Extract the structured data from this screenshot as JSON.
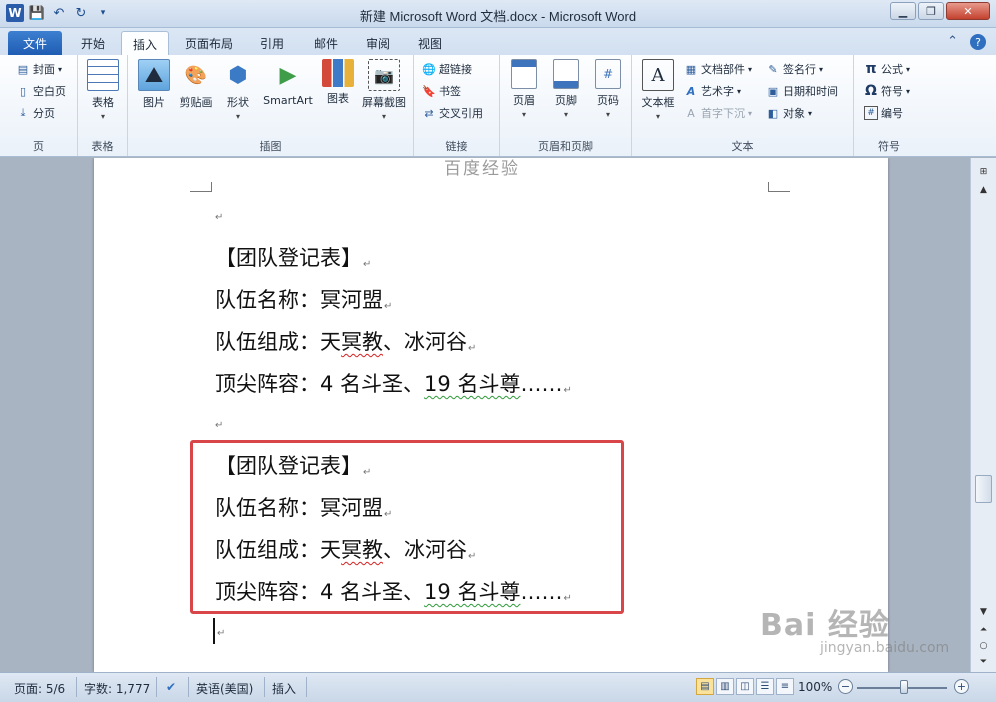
{
  "window": {
    "title": "新建 Microsoft Word 文档.docx - Microsoft Word",
    "app_icon": "W"
  },
  "tabs": {
    "file": "文件",
    "home": "开始",
    "insert": "插入",
    "page_layout": "页面布局",
    "references": "引用",
    "mailings": "邮件",
    "review": "审阅",
    "view": "视图"
  },
  "ribbon": {
    "pages": {
      "cover": "封面",
      "blank_page": "空白页",
      "page_break": "分页",
      "label": "页"
    },
    "tables": {
      "table": "表格",
      "label": "表格"
    },
    "illustrations": {
      "picture": "图片",
      "clip_art": "剪贴画",
      "shapes": "形状",
      "smartart": "SmartArt",
      "chart": "图表",
      "screenshot": "屏幕截图",
      "label": "插图"
    },
    "links": {
      "hyperlink": "超链接",
      "bookmark": "书签",
      "cross_reference": "交叉引用",
      "label": "链接"
    },
    "header_footer": {
      "header": "页眉",
      "footer": "页脚",
      "page_number": "页码",
      "label": "页眉和页脚"
    },
    "text": {
      "text_box": "文本框",
      "quick_parts": "文档部件",
      "wordart": "艺术字",
      "drop_cap": "首字下沉",
      "signature_line": "签名行",
      "date_time": "日期和时间",
      "object": "对象",
      "label": "文本"
    },
    "symbols": {
      "equation": "公式",
      "symbol": "符号",
      "numbering": "编号",
      "label": "符号"
    }
  },
  "document": {
    "header_watermark": "百度经验",
    "block1": {
      "title": "【团队登记表】",
      "name_label": "队伍名称：",
      "name_value": "冥河盟",
      "members_label": "队伍组成：",
      "members_a": "天",
      "members_b": "冥教",
      "members_c": "、冰河谷",
      "lineup_label": "顶尖阵容：",
      "lineup_a": "4 名斗圣、",
      "lineup_b": "19 名斗尊",
      "lineup_c": "……"
    },
    "block2": {
      "title": "【团队登记表】",
      "name_label": "队伍名称：",
      "name_value": "冥河盟",
      "members_label": "队伍组成：",
      "members_a": "天",
      "members_b": "冥教",
      "members_c": "、冰河谷",
      "lineup_label": "顶尖阵容：",
      "lineup_a": "4 名斗圣、",
      "lineup_b": "19 名斗尊",
      "lineup_c": "……"
    },
    "paragraph_mark": "↵",
    "highlight_color": "#d8464a"
  },
  "watermark": {
    "brand": "Bai 经验",
    "url": "jingyan.baidu.com"
  },
  "status": {
    "page": "页面: 5/6",
    "words": "字数: 1,777",
    "language": "英语(美国)",
    "mode": "插入",
    "zoom": "100%",
    "zoom_level_percent": 100
  }
}
